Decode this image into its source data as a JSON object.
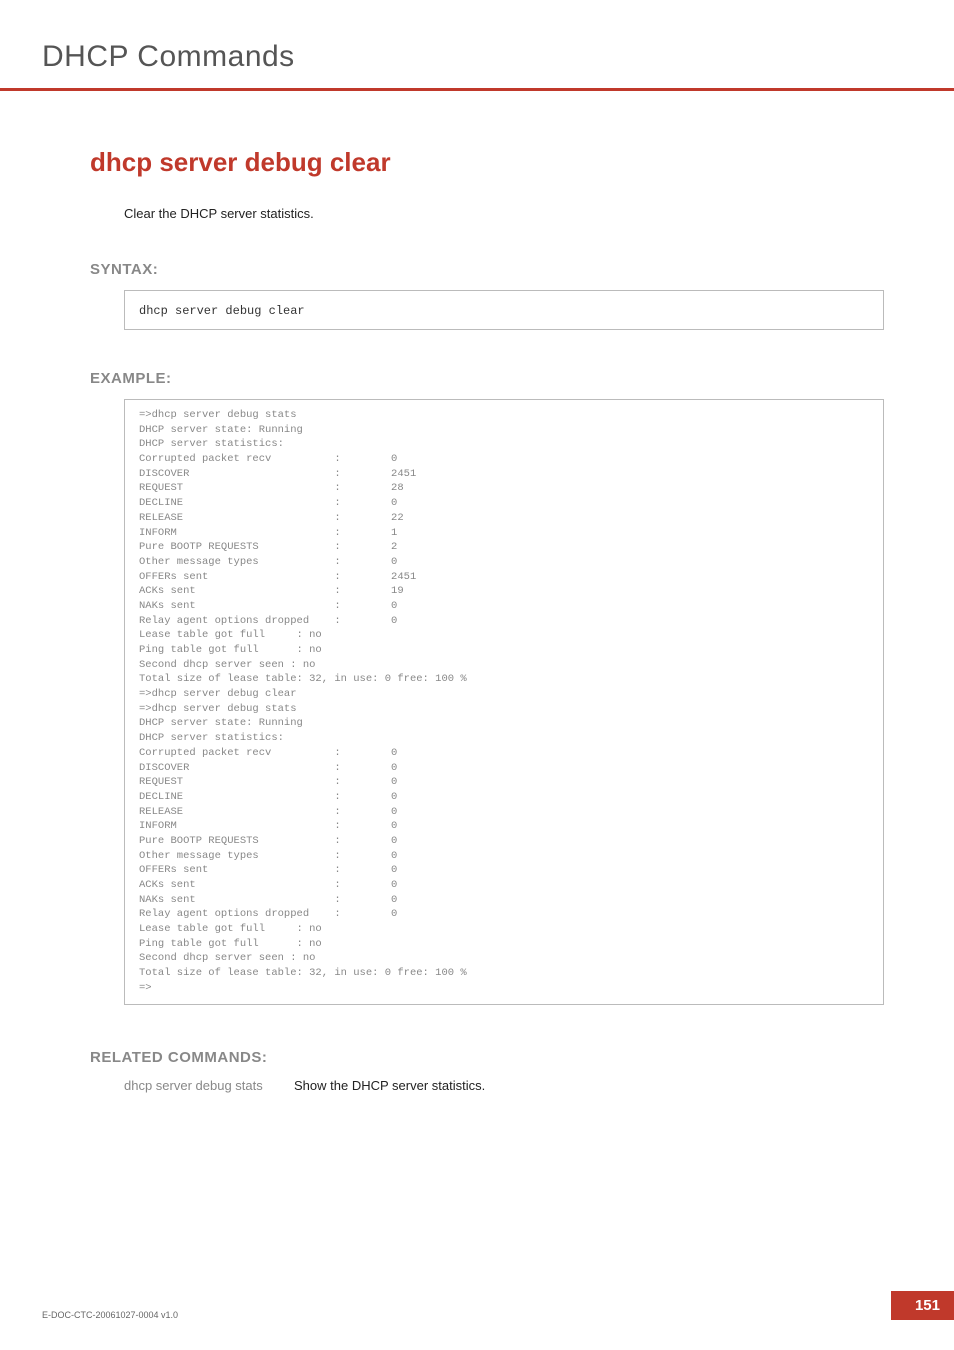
{
  "header": {
    "title": "DHCP Commands"
  },
  "command": {
    "title": "dhcp server debug clear",
    "description": "Clear the DHCP server statistics."
  },
  "syntax": {
    "label": "SYNTAX:",
    "code": "dhcp server debug clear"
  },
  "example": {
    "label": "EXAMPLE:",
    "output": "=>dhcp server debug stats\nDHCP server state: Running\nDHCP server statistics:\nCorrupted packet recv          :        0\nDISCOVER                       :        2451\nREQUEST                        :        28\nDECLINE                        :        0\nRELEASE                        :        22\nINFORM                         :        1\nPure BOOTP REQUESTS            :        2\nOther message types            :        0\nOFFERs sent                    :        2451\nACKs sent                      :        19\nNAKs sent                      :        0\nRelay agent options dropped    :        0\nLease table got full     : no\nPing table got full      : no\nSecond dhcp server seen : no\nTotal size of lease table: 32, in use: 0 free: 100 %\n=>dhcp server debug clear\n=>dhcp server debug stats\nDHCP server state: Running\nDHCP server statistics:\nCorrupted packet recv          :        0\nDISCOVER                       :        0\nREQUEST                        :        0\nDECLINE                        :        0\nRELEASE                        :        0\nINFORM                         :        0\nPure BOOTP REQUESTS            :        0\nOther message types            :        0\nOFFERs sent                    :        0\nACKs sent                      :        0\nNAKs sent                      :        0\nRelay agent options dropped    :        0\nLease table got full     : no\nPing table got full      : no\nSecond dhcp server seen : no\nTotal size of lease table: 32, in use: 0 free: 100 %\n=>"
  },
  "related": {
    "label": "RELATED COMMANDS:",
    "items": [
      {
        "cmd": "dhcp server debug stats",
        "desc": "Show the DHCP server statistics."
      }
    ]
  },
  "footer": {
    "doc_id": "E-DOC-CTC-20061027-0004 v1.0",
    "page": "151"
  }
}
